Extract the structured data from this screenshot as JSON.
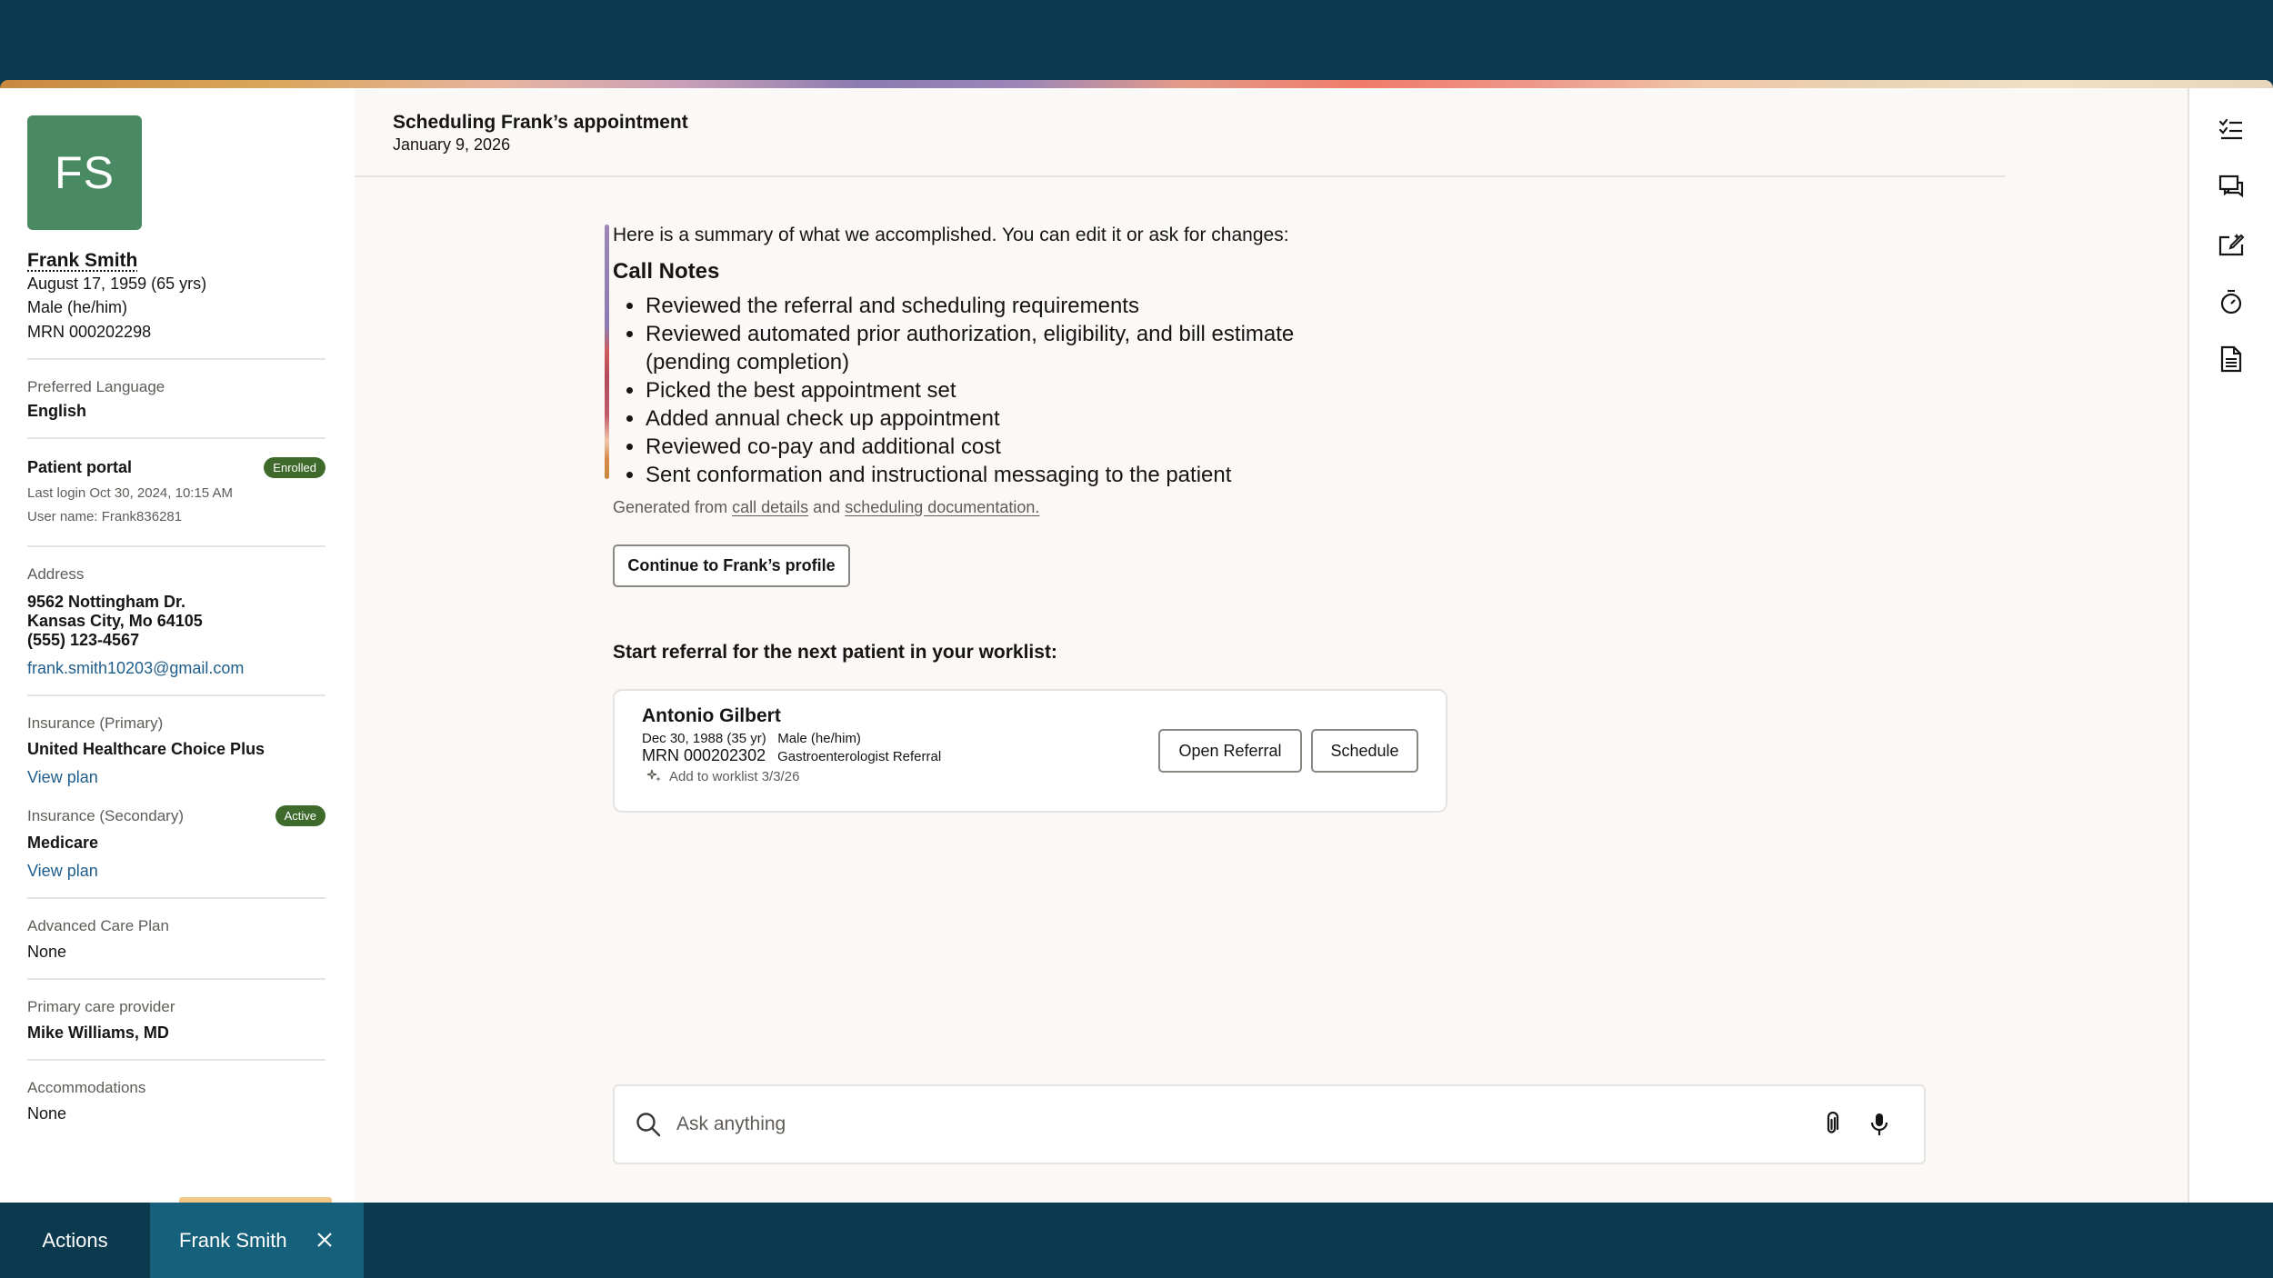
{
  "patient": {
    "initials": "FS",
    "name": "Frank Smith",
    "dob": "August 17, 1959 (65 yrs)",
    "sex": "Male (he/him)",
    "mrn": "MRN 000202298",
    "preferred_language_label": "Preferred Language",
    "preferred_language": "English",
    "portal_label": "Patient portal",
    "portal_badge": "Enrolled",
    "last_login": "Last login Oct 30, 2024, 10:15 AM",
    "username": "User name: Frank836281",
    "address_label": "Address",
    "address_line1": "9562 Nottingham Dr.",
    "address_line2": "Kansas City, Mo 64105",
    "phone": "(555) 123-4567",
    "email": "frank.smith10203@gmail.com",
    "ins_primary_label": "Insurance (Primary)",
    "ins_primary": "United Healthcare Choice Plus",
    "ins_primary_link": "View plan",
    "ins_secondary_label": "Insurance (Secondary)",
    "ins_secondary_badge": "Active",
    "ins_secondary": "Medicare",
    "ins_secondary_link": "View plan",
    "acp_label": "Advanced Care Plan",
    "acp": "None",
    "pcp_label": "Primary care provider",
    "pcp": "Mike Williams, MD",
    "accom_label": "Accommodations",
    "accom": "None"
  },
  "header": {
    "title": "Scheduling Frank’s appointment",
    "date": "January 9, 2026"
  },
  "summary": {
    "intro": "Here is a summary of what we accomplished. You can edit it or ask for changes:",
    "notes_title": "Call Notes",
    "notes": [
      "Reviewed the referral and scheduling requirements",
      "Reviewed automated prior authorization, eligibility, and bill estimate (pending completion)",
      "Picked the best appointment set",
      "Added annual check up appointment",
      "Reviewed co-pay and additional cost",
      "Sent conformation and instructional messaging to the patient"
    ],
    "generated_prefix": "Generated from",
    "generated_link1": "call details",
    "generated_and": "and",
    "generated_link2": "scheduling documentation.",
    "continue_label": "Continue to Frank’s profile"
  },
  "next_patient": {
    "heading": "Start referral for the next patient in your worklist:",
    "name": "Antonio Gilbert",
    "dob_sex": "Dec 30, 1988 (35 yr)   Male (he/him)",
    "mrn": "MRN 000202302",
    "referral": "Gastroenterologist Referral",
    "worklist": "Add to worklist 3/3/26",
    "open_label": "Open Referral",
    "schedule_label": "Schedule"
  },
  "ask": {
    "placeholder": "Ask anything"
  },
  "taskbar": {
    "actions": "Actions",
    "tab": "Frank Smith"
  },
  "rail_icons": [
    "checklist-icon",
    "chat-icon",
    "edit-export-icon",
    "timer-icon",
    "document-icon"
  ]
}
